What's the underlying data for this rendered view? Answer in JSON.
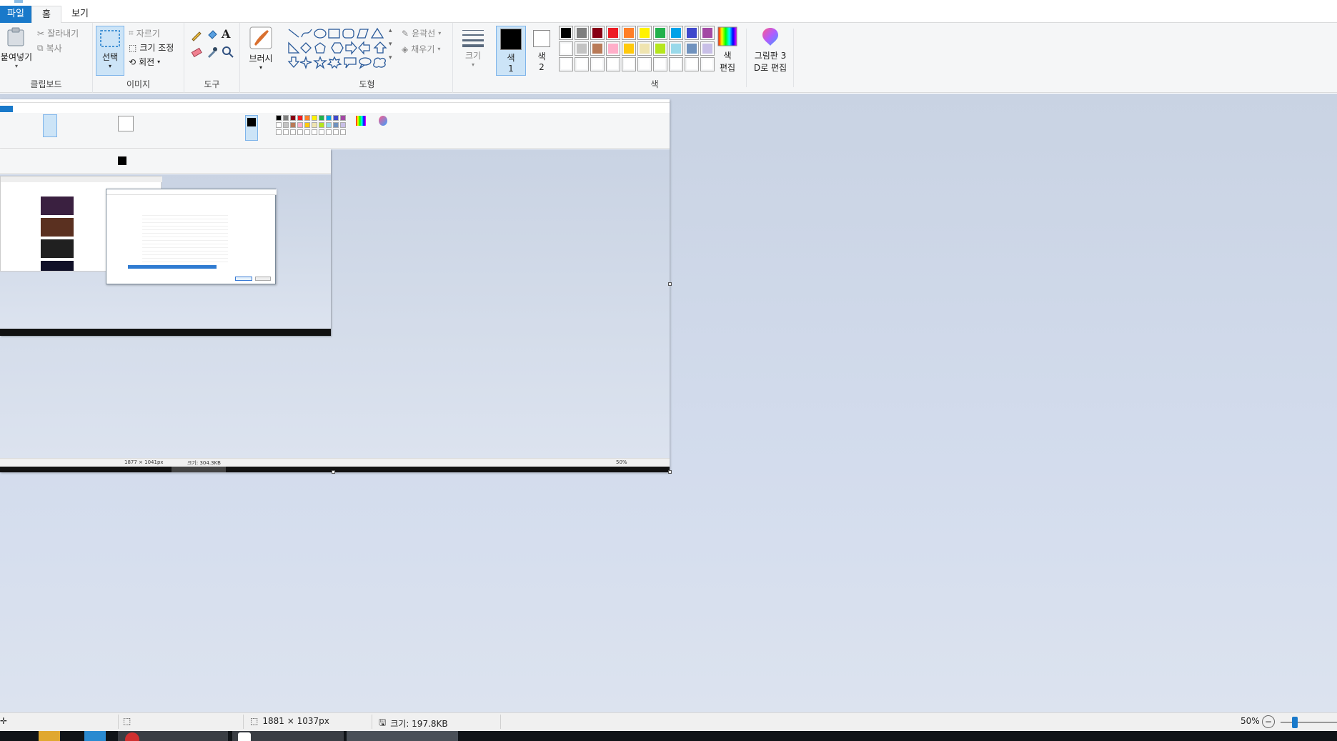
{
  "tabs": {
    "file": "파일",
    "home": "홈",
    "view": "보기"
  },
  "clipboard": {
    "paste": "붙여넣기",
    "cut": "잘라내기",
    "copy": "복사",
    "label": "클립보드"
  },
  "image": {
    "select": "선택",
    "crop": "자르기",
    "resize": "크기 조정",
    "rotate": "회전",
    "label": "이미지"
  },
  "tools": {
    "label": "도구"
  },
  "brushes": {
    "label": "브러시"
  },
  "shapes": {
    "outline": "윤곽선",
    "fill": "채우기",
    "label": "도형"
  },
  "size": {
    "label": "크기"
  },
  "color1": {
    "label": "색",
    "num": "1"
  },
  "color2": {
    "label": "색",
    "num": "2"
  },
  "colors": {
    "label": "색",
    "row1": [
      "#000000",
      "#7f7f7f",
      "#880015",
      "#ed1c24",
      "#ff7f27",
      "#fff200",
      "#22b14c",
      "#00a2e8",
      "#3f48cc",
      "#a349a4"
    ],
    "row2": [
      "#ffffff",
      "#c3c3c3",
      "#b97a57",
      "#ffaec9",
      "#ffc90e",
      "#efe4b0",
      "#b5e61d",
      "#99d9ea",
      "#7092be",
      "#c8bfe7"
    ],
    "row3": [
      "#ffffff",
      "#ffffff",
      "#ffffff",
      "#ffffff",
      "#ffffff",
      "#ffffff",
      "#ffffff",
      "#ffffff",
      "#ffffff",
      "#ffffff"
    ]
  },
  "edit_colors": {
    "line1": "색",
    "line2": "편집"
  },
  "paint3d": {
    "line1": "그림판 3",
    "line2": "D로 편집"
  },
  "status": {
    "dimensions": "1881 × 1037px",
    "size": "크기: 197.8KB",
    "zoom": "50%"
  },
  "nested": {
    "dimensions": "1877 × 1041px",
    "size": "크기: 304.3KB",
    "zoom": "50%"
  },
  "accent": "#1979ca"
}
